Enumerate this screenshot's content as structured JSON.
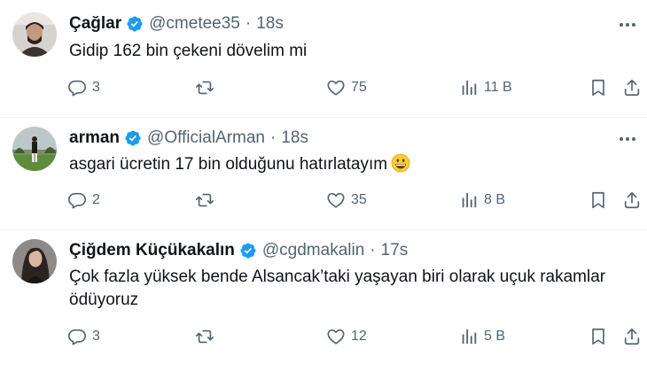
{
  "tweets": [
    {
      "name": "Çağlar",
      "handle": "@cmetee35",
      "time": "18s",
      "text": "Gidip 162 bin çekeni dövelim mi",
      "replies": "3",
      "retweets": "",
      "likes": "75",
      "views": "11 B"
    },
    {
      "name": "arman",
      "handle": "@OfficialArman",
      "time": "18s",
      "text": "asgari ücretin 17 bin olduğunu hatırlatayım",
      "replies": "2",
      "retweets": "",
      "likes": "35",
      "views": "8 B"
    },
    {
      "name": "Çiğdem Küçükakalın",
      "handle": "@cgdmakalin",
      "time": "17s",
      "text": "Çok fazla yüksek bende Alsancak’taki yaşayan biri olarak uçuk rakamlar ödüyoruz",
      "replies": "3",
      "retweets": "",
      "likes": "12",
      "views": "5 B"
    }
  ],
  "colors": {
    "verified": "#1d9bf0",
    "secondary": "#536471",
    "divider": "#eff3f4",
    "emoji": "#ffcc33"
  },
  "icons": [
    "verified-badge-icon",
    "more-icon",
    "reply-icon",
    "retweet-icon",
    "like-icon",
    "views-icon",
    "bookmark-icon",
    "share-icon",
    "grinning-emoji-icon"
  ]
}
